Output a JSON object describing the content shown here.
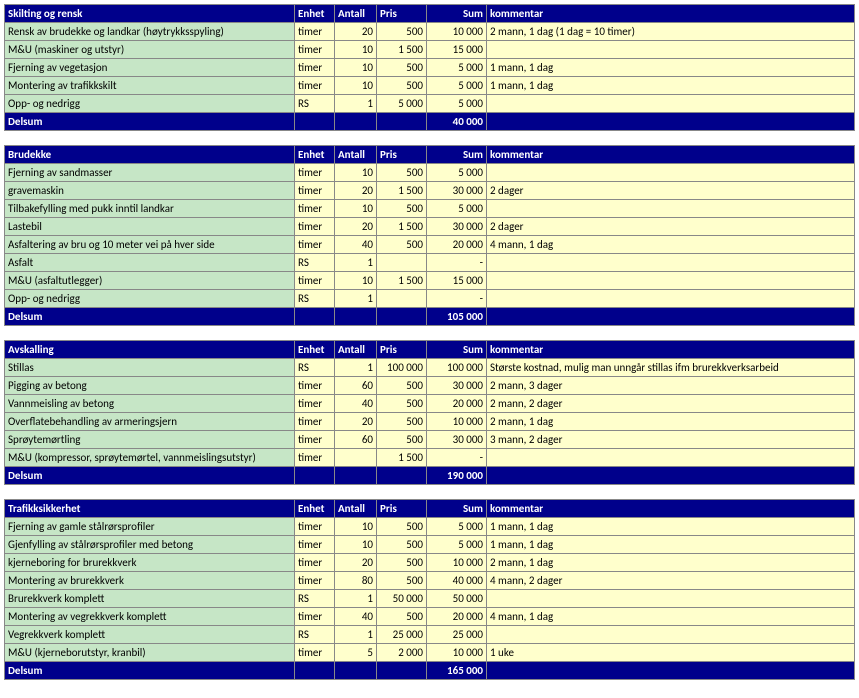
{
  "headers": {
    "enhet": "Enhet",
    "antall": "Antall",
    "pris": "Pris",
    "sum": "Sum",
    "kommentar": "kommentar",
    "delsum": "Delsum"
  },
  "sections": [
    {
      "title": "Skilting og rensk",
      "rows": [
        {
          "desc": "Rensk av brudekke og landkar (høytrykksspyling)",
          "enhet": "timer",
          "antall": "20",
          "pris": "500",
          "sum": "10 000",
          "kom": "2 mann, 1 dag (1 dag = 10 timer)"
        },
        {
          "desc": "M&U (maskiner og utstyr)",
          "enhet": "timer",
          "antall": "10",
          "pris": "1 500",
          "sum": "15 000",
          "kom": ""
        },
        {
          "desc": "Fjerning av vegetasjon",
          "enhet": "timer",
          "antall": "10",
          "pris": "500",
          "sum": "5 000",
          "kom": "1 mann, 1 dag"
        },
        {
          "desc": "Montering av trafikkskilt",
          "enhet": "timer",
          "antall": "10",
          "pris": "500",
          "sum": "5 000",
          "kom": "1 mann, 1 dag"
        },
        {
          "desc": "Opp- og nedrigg",
          "enhet": "RS",
          "antall": "1",
          "pris": "5 000",
          "sum": "5 000",
          "kom": ""
        }
      ],
      "delsum": "40 000"
    },
    {
      "title": "Brudekke",
      "rows": [
        {
          "desc": "Fjerning av sandmasser",
          "enhet": "timer",
          "antall": "10",
          "pris": "500",
          "sum": "5 000",
          "kom": ""
        },
        {
          "desc": "gravemaskin",
          "enhet": "timer",
          "antall": "20",
          "pris": "1 500",
          "sum": "30 000",
          "kom": "2 dager"
        },
        {
          "desc": "Tilbakefylling med pukk inntil landkar",
          "enhet": "timer",
          "antall": "10",
          "pris": "500",
          "sum": "5 000",
          "kom": ""
        },
        {
          "desc": "Lastebil",
          "enhet": "timer",
          "antall": "20",
          "pris": "1 500",
          "sum": "30 000",
          "kom": "2 dager"
        },
        {
          "desc": "Asfaltering av bru og 10 meter vei på hver side",
          "enhet": "timer",
          "antall": "40",
          "pris": "500",
          "sum": "20 000",
          "kom": "4 mann, 1 dag"
        },
        {
          "desc": "Asfalt",
          "enhet": "RS",
          "antall": "1",
          "pris": "",
          "sum": "-",
          "kom": ""
        },
        {
          "desc": "M&U (asfaltutlegger)",
          "enhet": "timer",
          "antall": "10",
          "pris": "1 500",
          "sum": "15 000",
          "kom": ""
        },
        {
          "desc": "Opp- og nedrigg",
          "enhet": "RS",
          "antall": "1",
          "pris": "",
          "sum": "-",
          "kom": ""
        }
      ],
      "delsum": "105 000"
    },
    {
      "title": "Avskalling",
      "rows": [
        {
          "desc": "Stillas",
          "enhet": "RS",
          "antall": "1",
          "pris": "100 000",
          "sum": "100 000",
          "kom": "Største kostnad, mulig man unngår stillas ifm brurekkverksarbeid"
        },
        {
          "desc": "Pigging av betong",
          "enhet": "timer",
          "antall": "60",
          "pris": "500",
          "sum": "30 000",
          "kom": "2 mann, 3 dager"
        },
        {
          "desc": "Vannmeisling av betong",
          "enhet": "timer",
          "antall": "40",
          "pris": "500",
          "sum": "20 000",
          "kom": "2 mann, 2 dager"
        },
        {
          "desc": "Overflatebehandling av armeringsjern",
          "enhet": "timer",
          "antall": "20",
          "pris": "500",
          "sum": "10 000",
          "kom": "2 mann, 1 dag"
        },
        {
          "desc": "Sprøytemørtling",
          "enhet": "timer",
          "antall": "60",
          "pris": "500",
          "sum": "30 000",
          "kom": "3 mann, 2 dager"
        },
        {
          "desc": "M&U (kompressor, sprøytemørtel, vannmeislingsutstyr)",
          "enhet": "timer",
          "antall": "",
          "pris": "1 500",
          "sum": "-",
          "kom": ""
        }
      ],
      "delsum": "190 000"
    },
    {
      "title": "Trafikksikkerhet",
      "rows": [
        {
          "desc": "Fjerning av gamle stålrørsprofiler",
          "enhet": "timer",
          "antall": "10",
          "pris": "500",
          "sum": "5 000",
          "kom": "1 mann, 1 dag"
        },
        {
          "desc": "Gjenfylling av stålrørsprofiler med betong",
          "enhet": "timer",
          "antall": "10",
          "pris": "500",
          "sum": "5 000",
          "kom": "1 mann, 1 dag"
        },
        {
          "desc": "kjerneboring for brurekkverk",
          "enhet": "timer",
          "antall": "20",
          "pris": "500",
          "sum": "10 000",
          "kom": "2 mann, 1 dag"
        },
        {
          "desc": "Montering av brurekkverk",
          "enhet": "timer",
          "antall": "80",
          "pris": "500",
          "sum": "40 000",
          "kom": "4 mann, 2 dager"
        },
        {
          "desc": "Brurekkverk komplett",
          "enhet": "RS",
          "antall": "1",
          "pris": "50 000",
          "sum": "50 000",
          "kom": ""
        },
        {
          "desc": "Montering av vegrekkverk komplett",
          "enhet": "timer",
          "antall": "40",
          "pris": "500",
          "sum": "20 000",
          "kom": "4 mann, 1 dag"
        },
        {
          "desc": "Vegrekkverk komplett",
          "enhet": "RS",
          "antall": "1",
          "pris": "25 000",
          "sum": "25 000",
          "kom": ""
        },
        {
          "desc": "M&U (kjerneborutstyr, kranbil)",
          "enhet": "timer",
          "antall": "5",
          "pris": "2 000",
          "sum": "10 000",
          "kom": "1 uke"
        }
      ],
      "delsum": "165 000"
    }
  ]
}
